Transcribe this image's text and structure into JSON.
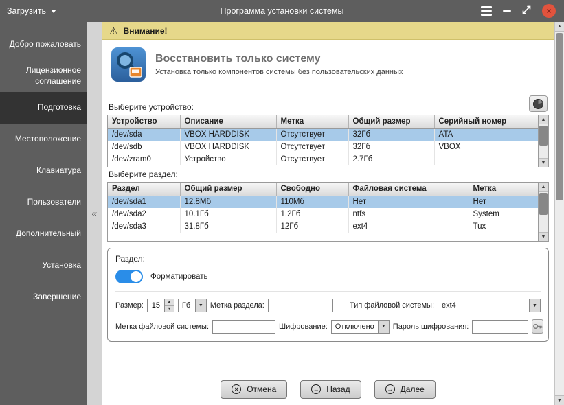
{
  "titlebar": {
    "load_label": "Загрузить",
    "title": "Программа установки системы"
  },
  "sidebar": {
    "collapse_glyph": "«",
    "active_item": "Подготовка",
    "items": [
      {
        "label": "Добро пожаловать"
      },
      {
        "label": "Лицензионное соглашение"
      },
      {
        "label": "Подготовка"
      },
      {
        "label": "Местоположение"
      },
      {
        "label": "Клавиатура"
      },
      {
        "label": "Пользователи"
      },
      {
        "label": "Дополнительный"
      },
      {
        "label": "Установка"
      },
      {
        "label": "Завершение"
      }
    ]
  },
  "warning": {
    "text": "Внимание!"
  },
  "header": {
    "title": "Восстановить только систему",
    "subtitle": "Установка только компонентов системы без пользовательских данных"
  },
  "device_section": {
    "label": "Выберите устройство:",
    "headers": [
      "Устройство",
      "Описание",
      "Метка",
      "Общий размер",
      "Серийный номер"
    ],
    "rows": [
      [
        "/dev/sda",
        "VBOX HARDDISK",
        "Отсутствует",
        "32Гб",
        "ATA"
      ],
      [
        "/dev/sdb",
        "VBOX HARDDISK",
        "Отсутствует",
        "32Гб",
        "VBOX"
      ],
      [
        "/dev/zram0",
        "Устройство",
        "Отсутствует",
        "2.7Гб",
        ""
      ]
    ],
    "selected_row": 0
  },
  "partition_section": {
    "label": "Выберите раздел:",
    "headers": [
      "Раздел",
      "Общий размер",
      "Свободно",
      "Файловая система",
      "Метка"
    ],
    "rows": [
      [
        "/dev/sda1",
        "12.8Мб",
        "110Мб",
        "Нет",
        "Нет"
      ],
      [
        "/dev/sda2",
        "10.1Гб",
        "1.2Гб",
        "ntfs",
        "System"
      ],
      [
        "/dev/sda3",
        "31.8Гб",
        "12Гб",
        "ext4",
        "Tux"
      ]
    ],
    "selected_row": 0
  },
  "partition_form": {
    "title": "Раздел:",
    "format_label": "Форматировать",
    "format_on": true,
    "size_label": "Размер:",
    "size_value": "15",
    "size_unit": "Гб",
    "label_label": "Метка раздела:",
    "label_value": "",
    "fstype_label": "Тип файловой системы:",
    "fstype_value": "ext4",
    "fslabel_label": "Метка файловой системы:",
    "fslabel_value": "",
    "encryption_label": "Шифрование:",
    "encryption_value": "Отключено",
    "password_label": "Пароль шифрования:",
    "password_value": ""
  },
  "footer": {
    "cancel": "Отмена",
    "back": "Назад",
    "next": "Далее"
  }
}
